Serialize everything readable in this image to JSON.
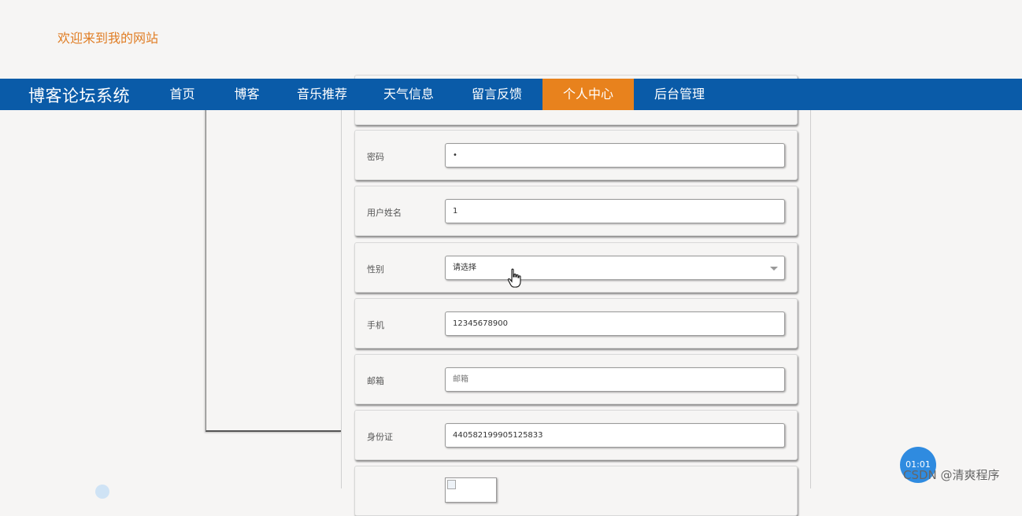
{
  "header": {
    "welcome": "欢迎来到我的网站"
  },
  "navbar": {
    "brand": "博客论坛系统",
    "items": [
      {
        "label": "首页"
      },
      {
        "label": "博客"
      },
      {
        "label": "音乐推荐"
      },
      {
        "label": "天气信息"
      },
      {
        "label": "留言反馈"
      },
      {
        "label": "个人中心"
      },
      {
        "label": "后台管理"
      }
    ],
    "active_item": "个人中心",
    "brand_color": "#0a5ba8",
    "active_color": "#e8821d"
  },
  "form": {
    "password": {
      "label": "密码",
      "value": "•"
    },
    "real_name": {
      "label": "用户姓名",
      "value": "1"
    },
    "gender": {
      "label": "性别",
      "placeholder": "请选择"
    },
    "phone": {
      "label": "手机",
      "value": "12345678900"
    },
    "email": {
      "label": "邮箱",
      "placeholder": "邮箱"
    },
    "id_card": {
      "label": "身份证",
      "value": "440582199905125833"
    }
  },
  "overlay": {
    "timer": "01:01",
    "watermark": "CSDN @清爽程序"
  },
  "icons": {
    "cursor": "hand-pointer-icon",
    "dropdown": "chevron-down-icon",
    "avatar": "broken-image-icon"
  }
}
